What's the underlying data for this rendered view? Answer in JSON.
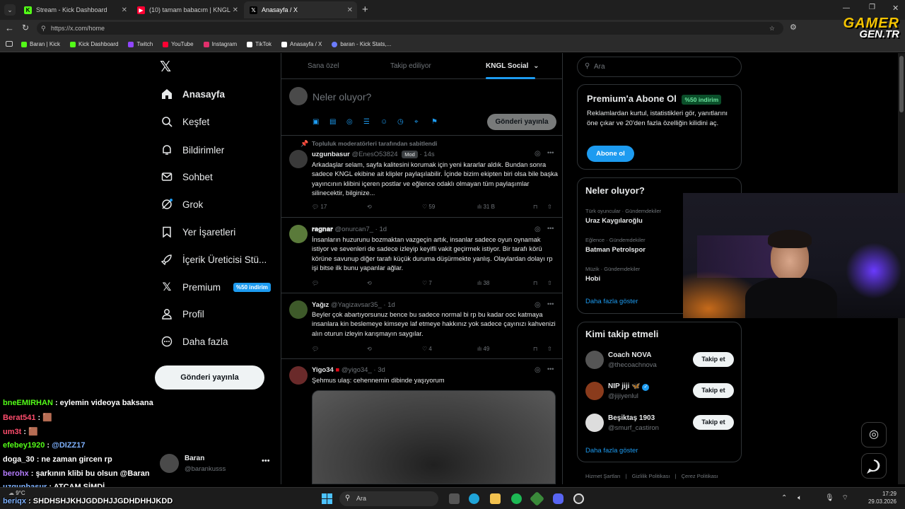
{
  "browser": {
    "tabs": [
      {
        "title": "Stream - Kick Dashboard",
        "fav": "K",
        "color": "#53fc18"
      },
      {
        "title": "(10) tamam babacım | KNGLRP - Yo",
        "fav": "▶",
        "color": "#ff0033"
      },
      {
        "title": "Anasayfa / X",
        "fav": "X",
        "color": "#ffffff"
      }
    ],
    "url": "https://x.com/home",
    "bookmarks": [
      {
        "label": "Baran | Kick",
        "color": "#53fc18"
      },
      {
        "label": "Kick Dashboard",
        "color": "#53fc18"
      },
      {
        "label": "Twitch",
        "color": "#9146ff"
      },
      {
        "label": "YouTube",
        "color": "#ff0033"
      },
      {
        "label": "Instagram",
        "color": "#e1306c"
      },
      {
        "label": "TikTok",
        "color": "#ffffff"
      },
      {
        "label": "Anasayfa / X",
        "color": "#ffffff"
      },
      {
        "label": "baran - Kick Stats,...",
        "color": "#6c7cff"
      }
    ]
  },
  "watermark": {
    "line1": "GAMER",
    "line2": "GEN.TR"
  },
  "nav": {
    "items": [
      {
        "label": "Anasayfa",
        "icon": "home-icon"
      },
      {
        "label": "Keşfet",
        "icon": "search-icon"
      },
      {
        "label": "Bildirimler",
        "icon": "bell-icon"
      },
      {
        "label": "Sohbet",
        "icon": "mail-icon"
      },
      {
        "label": "Grok",
        "icon": "grok-icon"
      },
      {
        "label": "Yer İşaretleri",
        "icon": "bookmark-icon"
      },
      {
        "label": "İçerik Üreticisi Stü...",
        "icon": "rocket-icon"
      },
      {
        "label": "Premium",
        "icon": "x-logo-icon"
      },
      {
        "label": "Profil",
        "icon": "person-icon"
      },
      {
        "label": "Daha fazla",
        "icon": "more-circle-icon"
      }
    ],
    "premium_badge": "%50 indirim",
    "post_button": "Gönderi yayınla",
    "account": {
      "name": "Baran",
      "handle": "@barankusss"
    }
  },
  "feed": {
    "tabs": [
      "Sana özel",
      "Takip ediliyor",
      "KNGL Social"
    ],
    "composer_placeholder": "Neler oluyor?",
    "composer_button": "Gönderi yayınla",
    "pinned_note": "Topluluk moderatörleri tarafından sabitlendi",
    "tweets": [
      {
        "name": "uzgunbasur",
        "handle": "@EnesO53824",
        "badge": "Mod",
        "time": "14s",
        "text": "Arkadaşlar selam, sayfa kalitesini korumak için yeni kararlar aldık. Bundan sonra sadece KNGL ekibine ait klipler paylaşılabilir. İçinde bizim ekipten biri olsa bile başka yayıncının klibini içeren postlar ve eğlence odaklı olmayan tüm paylaşımlar silinecektir, bilginize...",
        "replies": "17",
        "likes": "59",
        "views": "31 B"
      },
      {
        "name": "𝐫𝐚𝐠𝐧𝐚𝐫",
        "handle": "@onurcan7_",
        "time": "1d",
        "text": "İnsanların huzurunu bozmaktan vazgeçin artık, insanlar sadece oyun oynamak istiyor ve sevenleri de sadece izleyip keyifli vakit geçirmek istiyor. Bir tarafı körü körüne savunup diğer tarafı küçük duruma düşürmekte yanlış. Olaylardan dolayı rp işi bitse ilk bunu yapanlar ağlar.",
        "replies": "",
        "likes": "7",
        "views": "38"
      },
      {
        "name": "Yağız",
        "handle": "@Yagizavsar35_",
        "time": "1d",
        "text": "Beyler çok abartıyorsunuz bence bu sadece normal bi rp bu kadar ooc katmaya insanlara kin beslemeye kimseye laf etmeye hakkınız yok sadece çayınızı kahvenizi alın oturun izleyin karışmayın saygılar.",
        "replies": "",
        "likes": "4",
        "views": "49"
      },
      {
        "name": "Yigo34",
        "handle": "@yigo34_",
        "time": "3d",
        "text": "Şehmus ulaş: cehennemin dibinde yaşıyorum",
        "replies": "",
        "likes": "",
        "views": ""
      }
    ]
  },
  "sidebar": {
    "search_placeholder": "Ara",
    "premium": {
      "title": "Premium'a Abone Ol",
      "badge": "%50 indirim",
      "text": "Reklamlardan kurtul, istatistikleri gör, yanıtlarını öne çıkar ve 20'den fazla özelliğin kilidini aç.",
      "button": "Abone ol"
    },
    "trends_title": "Neler oluyor?",
    "trends": [
      {
        "category": "Türk oyuncular · Gündemdekiler",
        "name": "Uraz Kaygılaroğlu"
      },
      {
        "category": "Eğlence · Gündemdekiler",
        "name": "Batman Petrolspor"
      },
      {
        "category": "Müzik · Gündemdekiler",
        "name": "Hobi"
      }
    ],
    "show_more": "Daha fazla göster",
    "follow_title": "Kimi takip etmeli",
    "suggestions": [
      {
        "name": "Coach NOVA",
        "handle": "@thecoachnova",
        "color": "#555"
      },
      {
        "name": "NIP jiji 🦋",
        "handle": "@jijiyenlul",
        "color": "#8a3b1c"
      },
      {
        "name": "Beşiktaş 1903",
        "handle": "@smurf_castiron",
        "color": "#ddd"
      }
    ],
    "follow_label": "Takip et",
    "footer": [
      "Hizmet Şartları",
      "Gizlilik Politikası",
      "Çerez Politikası"
    ]
  },
  "chat": [
    {
      "user": "bneEMIRHAN",
      "msg": "eylemin videoya baksana",
      "color": "#53fc18"
    },
    {
      "user": "Berat541",
      "msg": "🟫",
      "color": "#ff4d6d"
    },
    {
      "user": "um3t",
      "msg": "🟫",
      "color": "#ff4d6d"
    },
    {
      "user": "efebey1920",
      "msg": "@DIZZ17",
      "color": "#53fc18"
    },
    {
      "user": "doga_30",
      "msg": "ne zaman gircen rp",
      "color": "#ffffff"
    },
    {
      "user": "berohx",
      "msg": "şarkının klibi bu olsun @Baran",
      "color": "#b57cff"
    },
    {
      "user": "uzgunbasur",
      "msg": "ATCAM ŞİMDİ",
      "color": "#7fb2ff"
    },
    {
      "user": "beriqx",
      "msg": "SHDHSHJKHJGDDHJJGDHDHHJKDD",
      "color": "#7fb2ff"
    }
  ],
  "taskbar": {
    "search": "Ara",
    "weather": "9°C",
    "time": "17:29",
    "date": "29.03.2026"
  }
}
